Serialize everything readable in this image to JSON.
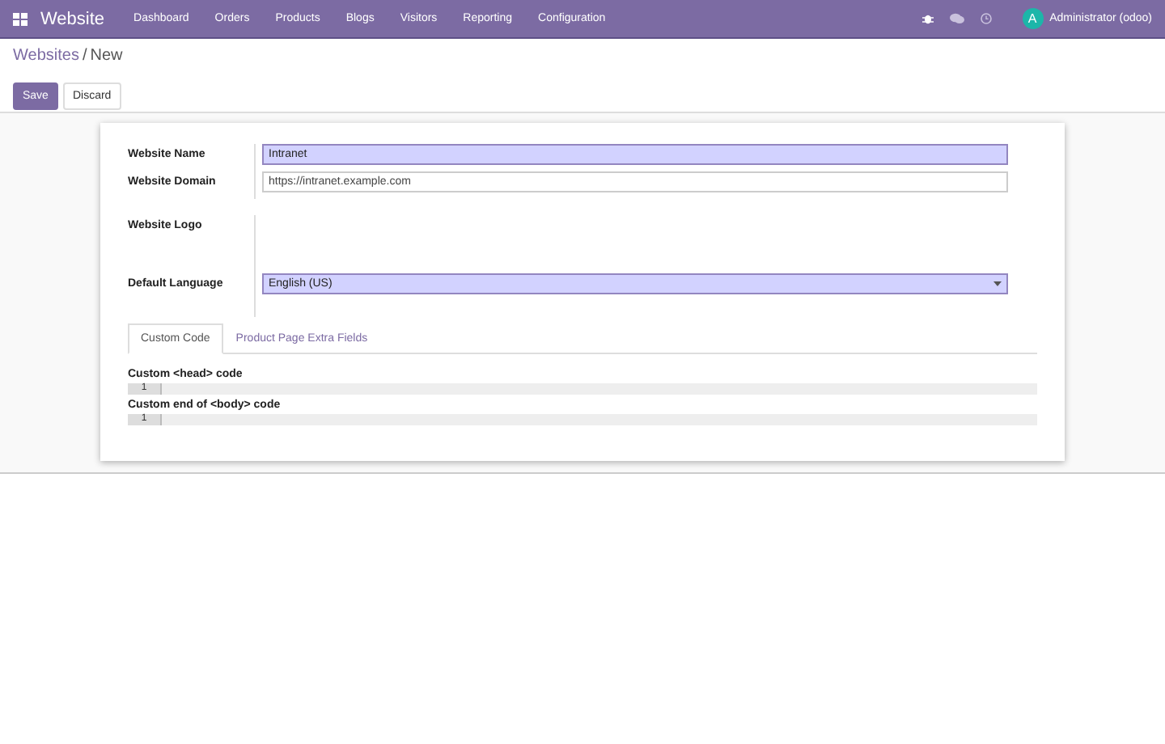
{
  "navbar": {
    "app_title": "Website",
    "menu": [
      "Dashboard",
      "Orders",
      "Products",
      "Blogs",
      "Visitors",
      "Reporting",
      "Configuration"
    ],
    "user": {
      "initial": "A",
      "name": "Administrator (odoo)"
    }
  },
  "breadcrumb_separator": "/",
  "breadcrumb": [
    {
      "label": "Websites",
      "kind": "link"
    },
    {
      "label": "New",
      "kind": "current"
    }
  ],
  "buttons": [
    {
      "label": "Save",
      "kind": "primary"
    },
    {
      "label": "Discard",
      "kind": "secondary"
    }
  ],
  "fields": [
    {
      "label": "Website Name",
      "kind": "text",
      "value": "Intranet",
      "required": true
    },
    {
      "label": "Website Domain",
      "kind": "text",
      "value": "https://intranet.example.com",
      "required": false
    },
    {
      "label": "Website Logo",
      "kind": "image"
    },
    {
      "label": "Default Language",
      "kind": "select",
      "value": "English (US)",
      "required": true
    }
  ],
  "tabs": [
    {
      "label": "Custom Code",
      "selected": true
    },
    {
      "label": "Product Page Extra Fields",
      "selected": false
    }
  ],
  "code_fields": [
    {
      "label": "Custom <head> code",
      "line_number": "1"
    },
    {
      "label": "Custom end of <body> code",
      "line_number": "1"
    }
  ]
}
